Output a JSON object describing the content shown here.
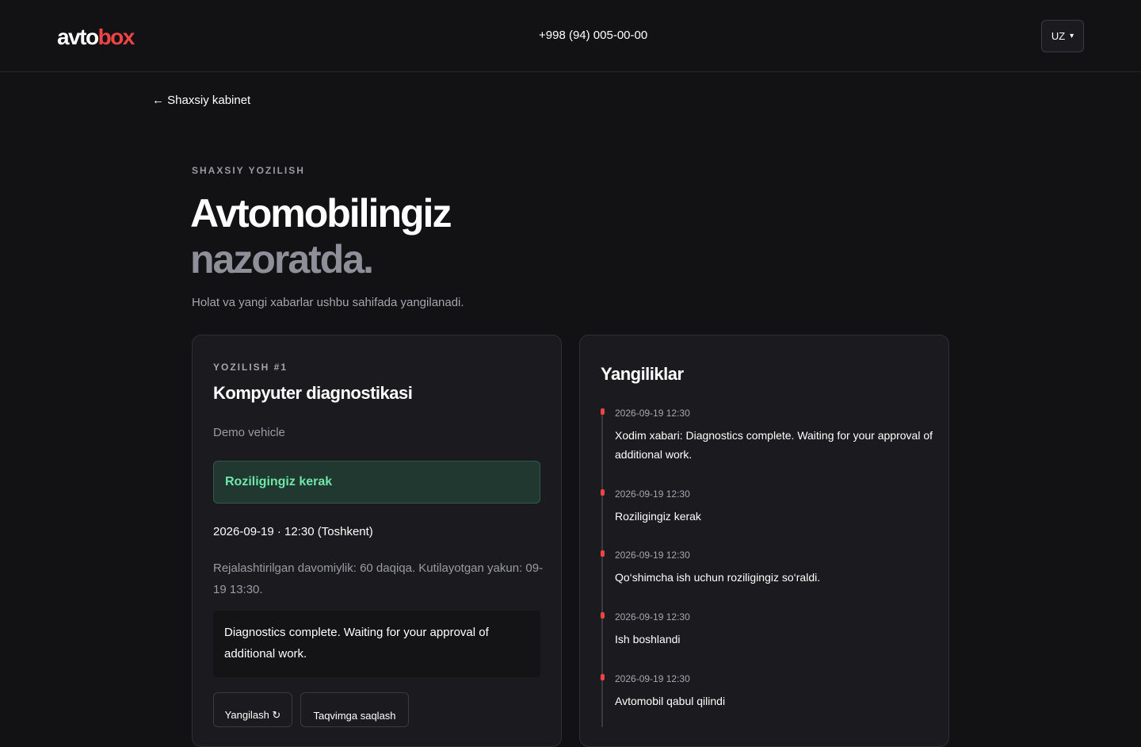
{
  "header": {
    "logo_part1": "avto",
    "logo_part2": "box",
    "phone": "+998 (94) 005-00-00",
    "language": "UZ"
  },
  "nav": {
    "back_label": "← Shaxsiy kabinet"
  },
  "hero": {
    "eyebrow": "SHAXSIY YOZILISH",
    "line1": "Avtomobilingiz",
    "line2": "nazoratda.",
    "subtitle": "Holat va yangi xabarlar ushbu sahifada yangilanadi."
  },
  "booking": {
    "eyebrow": "YOZILISH #1",
    "title": "Kompyuter diagnostikasi",
    "vehicle": "Demo vehicle",
    "status": "Roziligingiz kerak",
    "datetime": "2026-09-19 · 12:30 (Toshkent)",
    "duration": "Rejalashtirilgan davomiylik: 60 daqiqa. Kutilayotgan yakun: 09-19 13:30.",
    "note": "Diagnostics complete. Waiting for your approval of additional work.",
    "refresh_label": "Yangilash ↻",
    "calendar_label": "Taqvimga saqlash"
  },
  "news": {
    "title": "Yangiliklar",
    "items": [
      {
        "time": "2026-09-19 12:30",
        "text": "Xodim xabari: Diagnostics complete. Waiting for your approval of additional work."
      },
      {
        "time": "2026-09-19 12:30",
        "text": "Roziligingiz kerak"
      },
      {
        "time": "2026-09-19 12:30",
        "text": "Qo‘shimcha ish uchun roziligingiz so‘raldi."
      },
      {
        "time": "2026-09-19 12:30",
        "text": "Ish boshlandi"
      },
      {
        "time": "2026-09-19 12:30",
        "text": "Avtomobil qabul qilindi"
      }
    ]
  },
  "colors": {
    "accent": "#ef4444",
    "status_text": "#6ee7a8",
    "status_bg": "#20382f"
  }
}
